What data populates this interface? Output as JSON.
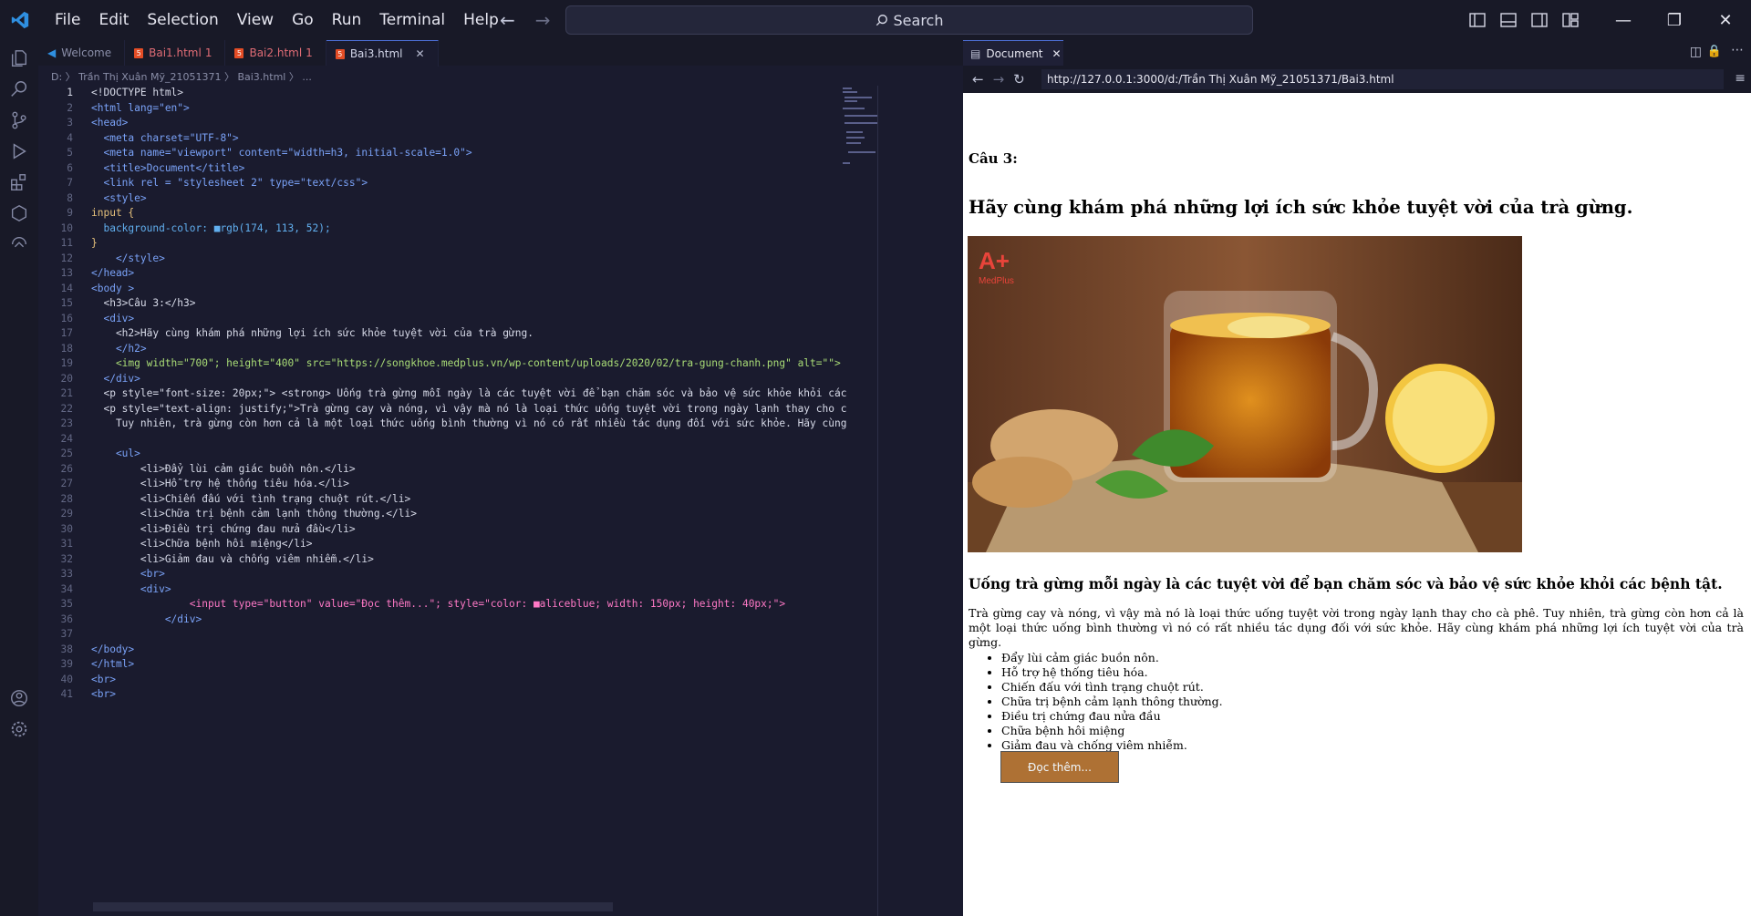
{
  "menu": [
    "File",
    "Edit",
    "Selection",
    "View",
    "Go",
    "Run",
    "Terminal",
    "Help"
  ],
  "search": {
    "label": "Search"
  },
  "tabs": [
    {
      "label": "Welcome",
      "modified": ""
    },
    {
      "label": "Bai1.html",
      "modified": "1"
    },
    {
      "label": "Bai2.html",
      "modified": "1"
    },
    {
      "label": "Bai3.html",
      "modified": ""
    }
  ],
  "breadcrumb": "D: 〉 Trần Thị Xuân Mỹ_21051371 〉 Bai3.html 〉 ...",
  "code_lines": [
    {
      "n": "1",
      "t": "<!DOCTYPE html>"
    },
    {
      "n": "2",
      "t": "<html lang=\"en\">"
    },
    {
      "n": "3",
      "t": "<head>"
    },
    {
      "n": "4",
      "t": "  <meta charset=\"UTF-8\">"
    },
    {
      "n": "5",
      "t": "  <meta name=\"viewport\" content=\"width=h3, initial-scale=1.0\">"
    },
    {
      "n": "6",
      "t": "  <title>Document</title>"
    },
    {
      "n": "7",
      "t": "  <link rel = \"stylesheet 2\" type=\"text/css\">"
    },
    {
      "n": "8",
      "t": "  <style>"
    },
    {
      "n": "9",
      "t": "input {"
    },
    {
      "n": "10",
      "t": "  background-color: ■rgb(174, 113, 52);"
    },
    {
      "n": "11",
      "t": "}"
    },
    {
      "n": "12",
      "t": "    </style>"
    },
    {
      "n": "13",
      "t": "</head>"
    },
    {
      "n": "14",
      "t": "<body >"
    },
    {
      "n": "15",
      "t": "  <h3>Câu 3:</h3>"
    },
    {
      "n": "16",
      "t": "  <div>"
    },
    {
      "n": "17",
      "t": "    <h2>Hãy cùng khám phá những lợi ích sức khỏe tuyệt vời của trà gừng."
    },
    {
      "n": "18",
      "t": "    </h2>"
    },
    {
      "n": "19",
      "t": "    <img width=\"700\"; height=\"400\" src=\"https://songkhoe.medplus.vn/wp-content/uploads/2020/02/tra-gung-chanh.png\" alt=\"\">"
    },
    {
      "n": "20",
      "t": "  </div>"
    },
    {
      "n": "21",
      "t": "  <p style=\"font-size: 20px;\"> <strong> Uống trà gừng mỗi ngày là các tuyệt vời để bạn chăm sóc và bảo vệ sức khỏe khỏi các"
    },
    {
      "n": "22",
      "t": "  <p style=\"text-align: justify;\">Trà gừng cay và nóng, vì vậy mà nó là loại thức uống tuyệt vời trong ngày lạnh thay cho c"
    },
    {
      "n": "23",
      "t": "    Tuy nhiên, trà gừng còn hơn cả là một loại thức uống bình thường vì nó có rất nhiều tác dụng đối với sức khỏe. Hãy cùng"
    },
    {
      "n": "24",
      "t": ""
    },
    {
      "n": "25",
      "t": "    <ul>"
    },
    {
      "n": "26",
      "t": "        <li>Đẩy lùi cảm giác buồn nôn.</li>"
    },
    {
      "n": "27",
      "t": "        <li>Hỗ trợ hệ thống tiêu hóa.</li>"
    },
    {
      "n": "28",
      "t": "        <li>Chiến đấu với tình trạng chuột rút.</li>"
    },
    {
      "n": "29",
      "t": "        <li>Chữa trị bệnh cảm lạnh thông thường.</li>"
    },
    {
      "n": "30",
      "t": "        <li>Điều trị chứng đau nửa đầu</li>"
    },
    {
      "n": "31",
      "t": "        <li>Chữa bệnh hôi miệng</li>"
    },
    {
      "n": "32",
      "t": "        <li>Giảm đau và chống viêm nhiễm.</li>"
    },
    {
      "n": "33",
      "t": "        <br>"
    },
    {
      "n": "34",
      "t": "        <div>"
    },
    {
      "n": "35",
      "t": "                <input type=\"button\" value=\"Đọc thêm...\"; style=\"color: ■aliceblue; width: 150px; height: 40px;\">"
    },
    {
      "n": "36",
      "t": "            </div>"
    },
    {
      "n": "37",
      "t": ""
    },
    {
      "n": "38",
      "t": "</body>"
    },
    {
      "n": "39",
      "t": "</html>"
    },
    {
      "n": "40",
      "t": "<br>"
    },
    {
      "n": "41",
      "t": "<br>"
    }
  ],
  "preview": {
    "tab_label": "Document",
    "url": "http://127.0.0.1:3000/d:/Trần Thị Xuân Mỹ_21051371/Bai3.html",
    "h3": "Câu 3:",
    "h2": "Hãy cùng khám phá những lợi ích sức khỏe tuyệt vời của trà gừng.",
    "logo_text": "MedPlus",
    "lead": "Uống trà gừng mỗi ngày là các tuyệt vời để bạn chăm sóc và bảo vệ sức khỏe khỏi các bệnh tật.",
    "paragraph": "Trà gừng cay và nóng, vì vậy mà nó là loại thức uống tuyệt vời trong ngày lạnh thay cho cà phê. Tuy nhiên, trà gừng còn hơn cả là một loại thức uống bình thường vì nó có rất nhiều tác dụng đối với sức khỏe. Hãy cùng khám phá những lợi ích tuyệt vời của trà gừng.",
    "list": [
      "Đẩy lùi cảm giác buồn nôn.",
      "Hỗ trợ hệ thống tiêu hóa.",
      "Chiến đấu với tình trạng chuột rút.",
      "Chữa trị bệnh cảm lạnh thông thường.",
      "Điều trị chứng đau nửa đầu",
      "Chữa bệnh hôi miệng",
      "Giảm đau và chống viêm nhiễm."
    ],
    "button": "Đọc thêm...",
    "button_color": "#ae7134"
  }
}
